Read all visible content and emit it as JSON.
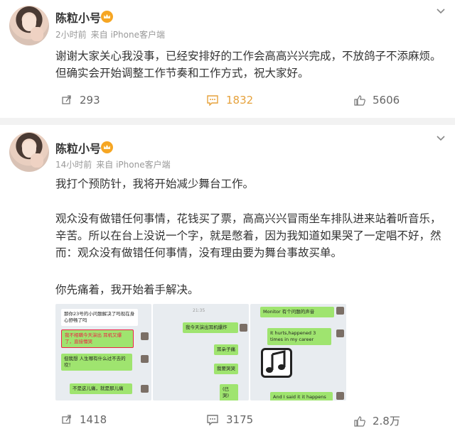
{
  "posts": [
    {
      "user": "陈粒小号",
      "time": "2小时前",
      "source": "来自 iPhone客户端",
      "text": "谢谢大家关心我没事，已经安排好的工作会高高兴兴完成，不放鸽子不添麻烦。但确实会开始调整工作节奏和工作方式，祝大家好。",
      "reposts": "293",
      "comments": "1832",
      "likes": "5606"
    },
    {
      "user": "陈粒小号",
      "time": "14小时前",
      "source": "来自 iPhone客户端",
      "paragraphs": [
        "我打个预防针，我将开始减少舞台工作。",
        "观众没有做错任何事情，花钱买了票，高高兴兴冒雨坐车排队进来站着听音乐，辛苦。所以在台上没说一个字，就是憋着，因为我知道如果哭了一定唱不好，然而：观众没有做错任何事情，没有理由要为舞台事故买单。",
        "你先痛着，我开始着手解决。"
      ],
      "images": {
        "img1": {
          "b1": "那你23号的小问题解决了吗现在身心舒畅了吗",
          "b2": "我不相瞒今天演出 耳机又爆了，直接懵哭",
          "b3": "但我想 人生哪有什么过不去的坎！",
          "b4": "不是这儿痛，就是那儿痛"
        },
        "img2": {
          "time": "21:35",
          "b1": "我今天演出耳机爆炸",
          "b2": "耳朵子痛",
          "b3": "我要哭哭",
          "b4": "(已哭)"
        },
        "img3": {
          "b1": "Monitor 有个问题的声音",
          "b2": "It hurts,happened 3 times in my career",
          "b3": "And I said it it happens again I"
        }
      },
      "reposts": "1418",
      "comments": "3175",
      "likes": "2.8万"
    }
  ],
  "colors": {
    "accent": "#e6a23c",
    "crown": "#f6a623",
    "bubble_green": "#9fe46f"
  }
}
